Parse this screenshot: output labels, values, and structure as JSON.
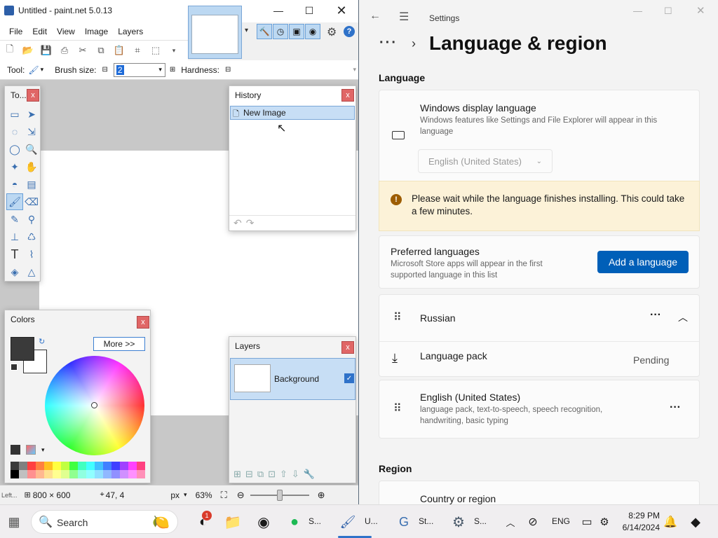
{
  "paintnet": {
    "title": "Untitled - paint.net 5.0.13",
    "menu": [
      "File",
      "Edit",
      "View",
      "Image",
      "Layers"
    ],
    "tool_label": "Tool:",
    "brush_size_label": "Brush size:",
    "brush_size_value": "2",
    "hardness_label": "Hardness:",
    "tools_panel_title": "To...",
    "history": {
      "title": "History",
      "items": [
        "New Image"
      ]
    },
    "colors": {
      "title": "Colors",
      "more_button": "More >>",
      "primary_color": "#3a3a3a",
      "secondary_color": "#ffffff"
    },
    "layers": {
      "title": "Layers",
      "items": [
        {
          "name": "Background",
          "visible": true
        }
      ]
    },
    "status": {
      "hint": "Left...",
      "image_size": "800 × 600",
      "cursor_pos": "47, 4",
      "units": "px",
      "zoom": "63%"
    },
    "palette": [
      "#3a3a3a",
      "#808080",
      "#ff4040",
      "#ff8040",
      "#ffc020",
      "#ffff40",
      "#c0ff40",
      "#40ff40",
      "#40ffc0",
      "#40ffff",
      "#40c0ff",
      "#4080ff",
      "#4040ff",
      "#a040ff",
      "#ff40ff",
      "#ff4080",
      "#000000",
      "#c0c0c0",
      "#ff9090",
      "#ffb890",
      "#ffe090",
      "#ffff90",
      "#e0ff90",
      "#90ff90",
      "#90ffe0",
      "#90ffff",
      "#90e0ff",
      "#90b8ff",
      "#9090ff",
      "#d090ff",
      "#ff90ff",
      "#ff90b8"
    ]
  },
  "settings": {
    "app_title": "Settings",
    "page_title": "Language & region",
    "language_section": "Language",
    "display_language": {
      "title": "Windows display language",
      "desc": "Windows features like Settings and File Explorer will appear in this language",
      "selected": "English (United States)"
    },
    "warning": "Please wait while the language finishes installing. This could take a few minutes.",
    "preferred": {
      "title": "Preferred languages",
      "desc": "Microsoft Store apps will appear in the first supported language in this list",
      "add_button": "Add a language"
    },
    "languages": [
      {
        "name": "Russian",
        "sub_label": "Language pack",
        "sub_status": "Pending"
      },
      {
        "name": "English (United States)",
        "desc": "language pack, text-to-speech, speech recognition, handwriting, basic typing"
      }
    ],
    "region_section": "Region",
    "country_label": "Country or region"
  },
  "taskbar": {
    "search_placeholder": "Search",
    "apps": [
      {
        "label": "S..."
      },
      {
        "label": "U..."
      },
      {
        "label": "St..."
      },
      {
        "label": "S..."
      }
    ],
    "badge_count": "1",
    "language": "ENG",
    "time": "8:29 PM",
    "date": "6/14/2024"
  }
}
